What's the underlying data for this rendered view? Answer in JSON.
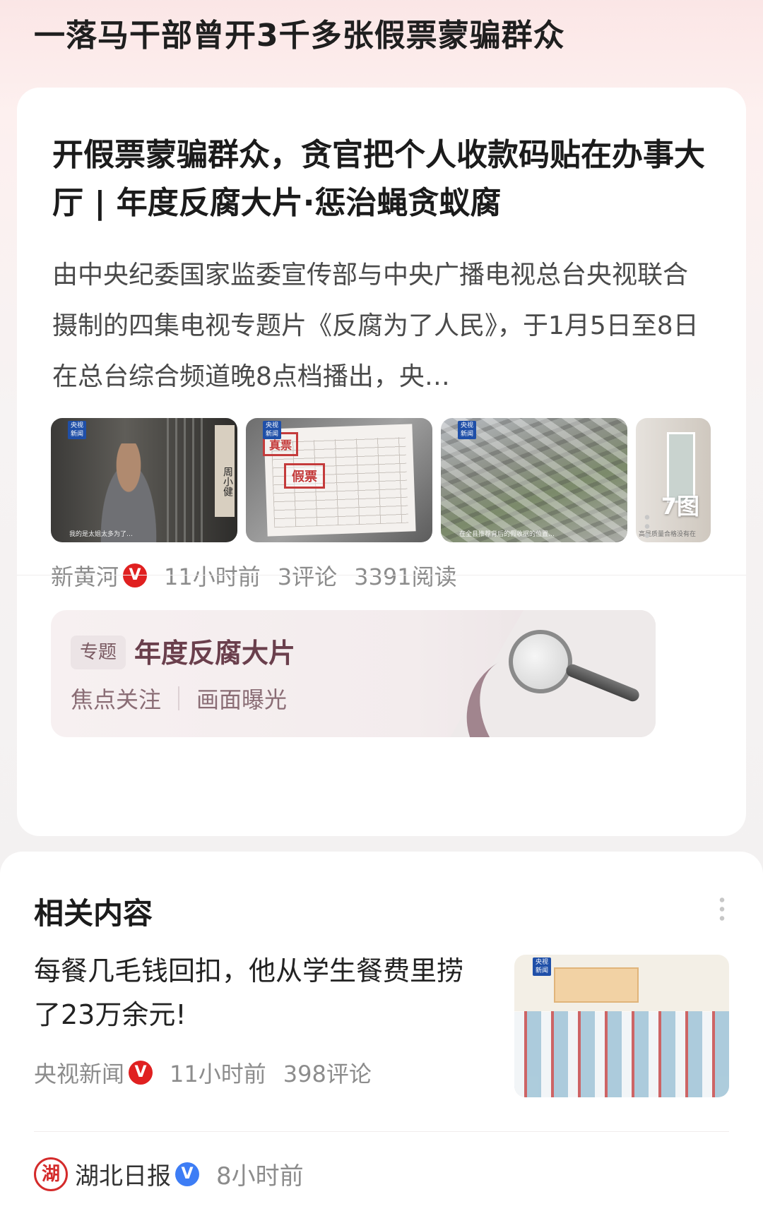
{
  "page": {
    "title": "一落马干部曾开3千多张假票蒙骗群众"
  },
  "article": {
    "headline": "开假票蒙骗群众，贪官把个人收款码贴在办事大厅 | 年度反腐大片·惩治蝇贪蚁腐",
    "summary": "由中央纪委国家监委宣传部与中央广播电视总台央视联合摄制的四集电视专题片《反腐为了人民》，于1月5日至8日在总台综合频道晚8点档播出，央…",
    "thumbnails": {
      "logo_text": "央视\n新闻",
      "t1_sign": "周小健",
      "t1_caption": "我的是太姐太多为了…",
      "t2_stamp1": "真票",
      "t2_stamp2": "假票",
      "t3_caption": "在全县推荐背后的假收据的位置…",
      "t4_caption": "高是质量合格没有在",
      "image_count": "7图"
    },
    "source": "新黄河",
    "verified_badge": "V",
    "time": "11小时前",
    "comments": "3评论",
    "reads": "3391阅读",
    "more_icon": "more-vertical-icon"
  },
  "topic": {
    "tag": "专题",
    "title": "年度反腐大片",
    "link1": "焦点关注",
    "link2": "画面曝光",
    "decoration_icon": "magnifying-glass-icon"
  },
  "related": {
    "section_title": "相关内容",
    "item": {
      "headline": "每餐几毛钱回扣，他从学生餐费里捞了23万余元!",
      "source": "央视新闻",
      "verified_badge": "V",
      "time": "11小时前",
      "comments": "398评论",
      "logo_text": "央视\n新闻"
    },
    "next": {
      "source_logo": "湖",
      "source": "湖北日报",
      "verified_badge": "V",
      "time": "8小时前"
    }
  }
}
